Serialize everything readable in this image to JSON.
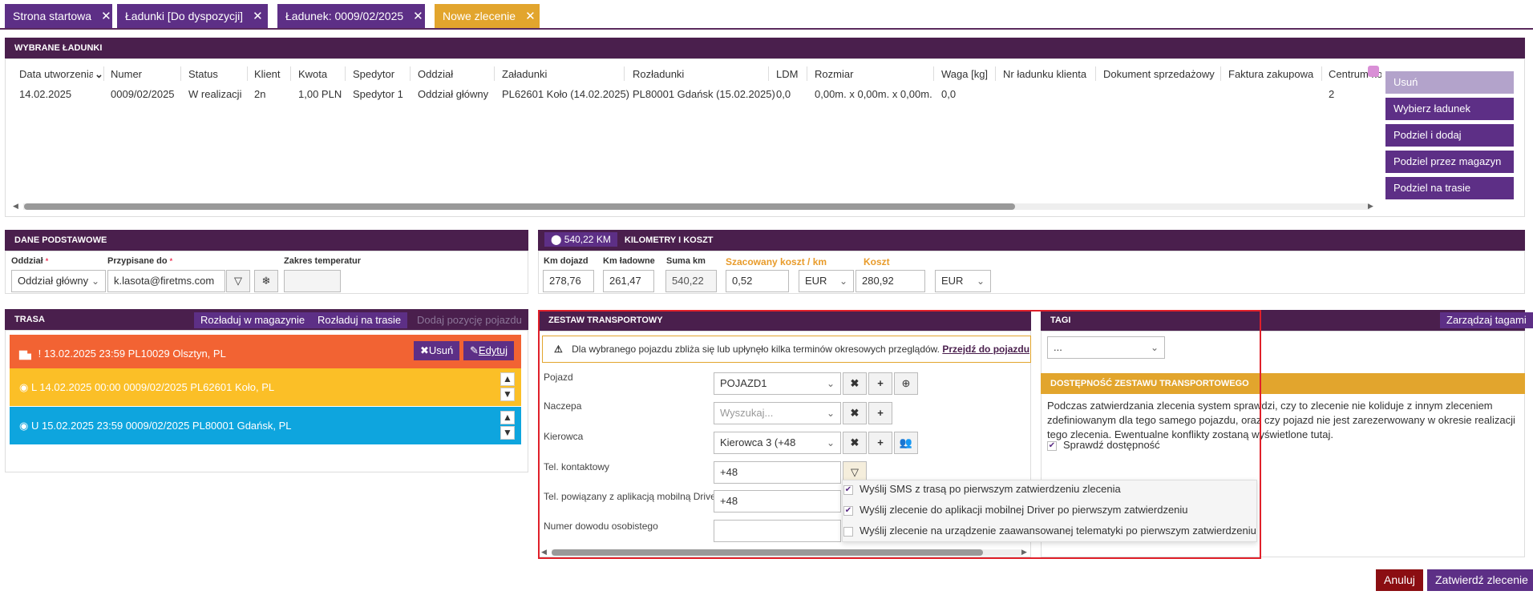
{
  "tabs": [
    {
      "label": "Strona startowa",
      "color": "#5d2f86"
    },
    {
      "label": "Ładunki [Do dyspozycji]",
      "color": "#5d2f86"
    },
    {
      "label": "Ładunek: 0009/02/2025",
      "color": "#5d2f86"
    },
    {
      "label": "Nowe zlecenie",
      "color": "#e2a52d"
    }
  ],
  "tab_close_glyph": "✕",
  "loads": {
    "header": "WYBRANE ŁADUNKI",
    "columns": [
      "Data utworzenia",
      "Numer",
      "Status",
      "Klient",
      "Kwota",
      "Spedytor",
      "Oddział",
      "Załadunki",
      "Rozładunki",
      "LDM",
      "Rozmiar",
      "Waga [kg]",
      "Nr ładunku klienta",
      "Dokument sprzedażowy",
      "Faktura zakupowa",
      "Centrum kosztów"
    ],
    "row": [
      "14.02.2025",
      "0009/02/2025",
      "W realizacji",
      "2n",
      "1,00 PLN",
      "Spedytor 1",
      "Oddział główny",
      "PL62601 Koło (14.02.2025)",
      "PL80001 Gdańsk (15.02.2025)",
      "0,0",
      "0,00m. x 0,00m. x 0,00m.",
      "0,0",
      "",
      "",
      "",
      "2"
    ],
    "side_buttons": [
      "Usuń",
      "Wybierz ładunek",
      "Podziel i dodaj",
      "Podziel przez magazyn",
      "Podziel na trasie"
    ]
  },
  "basic": {
    "header": "DANE PODSTAWOWE",
    "branch_label": "Oddział",
    "branch_value": "Oddział główny",
    "assigned_label": "Przypisane do",
    "assigned_value": "k.lasota@firetms.com",
    "temp_label": "Zakres temperatur",
    "required_mark": "*"
  },
  "km": {
    "badge": "540,22 KM",
    "header": "KILOMETRY I KOSZT",
    "approach_label": "Km dojazd",
    "approach_value": "278,76",
    "loaded_label": "Km ładowne",
    "loaded_value": "261,47",
    "sum_label": "Suma km",
    "sum_value": "540,22",
    "est_label": "Szacowany koszt / km",
    "est_value": "0,52",
    "est_currency": "EUR",
    "cost_label": "Koszt",
    "cost_value": "280,92",
    "cost_currency": "EUR"
  },
  "route": {
    "header": "TRASA",
    "btn_unload_wh": "Rozładuj w magazynie",
    "btn_unload_route": "Rozładuj na trasie",
    "btn_add_pos": "Dodaj pozycję pojazdu",
    "rows": [
      {
        "text": "! 13.02.2025 23:59   PL10029 Olsztyn, PL",
        "color": "#f26333"
      },
      {
        "text": "L 14.02.2025 00:00   0009/02/2025 PL62601 Koło, PL",
        "color": "#fbbf27"
      },
      {
        "text": "U 15.02.2025 23:59   0009/02/2025 PL80001 Gdańsk, PL",
        "color": "#0ea5de"
      }
    ],
    "delete_label": "Usuń",
    "edit_label": "Edytuj"
  },
  "zestaw": {
    "header": "ZESTAW TRANSPORTOWY",
    "warning": "Dla wybranego pojazdu zbliża się lub upłynęło kilka terminów okresowych przeglądów.",
    "warning_link": "Przejdź do pojazdu",
    "vehicle_label": "Pojazd",
    "vehicle_value": "POJAZD1",
    "trailer_label": "Naczepa",
    "trailer_placeholder": "Wyszukaj...",
    "driver_label": "Kierowca",
    "driver_value": "Kierowca 3 (+48",
    "phone_label": "Tel. kontaktowy",
    "phone_value": "+48",
    "app_phone_label": "Tel. powiązany z aplikacją mobilną Driver",
    "app_phone_value": "+48",
    "id_label": "Numer dowodu osobistego",
    "id_value": ""
  },
  "dropdown_options": [
    {
      "label": "Wyślij SMS z trasą po pierwszym zatwierdzeniu zlecenia",
      "checked": true
    },
    {
      "label": "Wyślij zlecenie do aplikacji mobilnej Driver po pierwszym zatwierdzeniu",
      "checked": true
    },
    {
      "label": "Wyślij zlecenie na urządzenie zaawansowanej telematyki po pierwszym zatwierdzeniu",
      "checked": false
    }
  ],
  "tags": {
    "header": "TAGI",
    "manage_btn": "Zarządzaj tagami",
    "select_value": "..."
  },
  "availability": {
    "header": "DOSTĘPNOŚĆ ZESTAWU TRANSPORTOWEGO",
    "text": "Podczas zatwierdzania zlecenia system sprawdzi, czy to zlecenie nie koliduje z innym zleceniem zdefiniowanym dla tego samego pojazdu, oraz czy pojazd nie jest zarezerwowany w okresie realizacji tego zlecenia. Ewentualne konflikty zostaną wyświetlone tutaj.",
    "check_label": "Sprawdź dostępność",
    "checked": true
  },
  "footer": {
    "cancel": "Anuluj",
    "confirm": "Zatwierdź zlecenie"
  },
  "colors": {
    "panel_header": "#4a1f4d",
    "button_purple": "#5d2f86",
    "tab_active": "#e2a52d",
    "cancel_red": "#8b0e12",
    "availability_header": "#e2a52d",
    "highlight_border": "#e0202a"
  }
}
